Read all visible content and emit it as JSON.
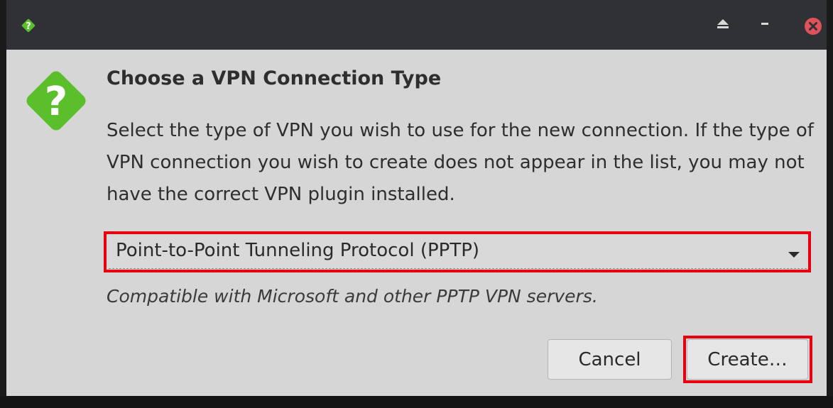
{
  "titlebar": {
    "app_icon": "question-diamond-icon",
    "buttons": [
      "eject-icon",
      "minimize-icon",
      "close-icon"
    ]
  },
  "dialog": {
    "icon": "question-diamond-icon",
    "heading": "Choose a VPN Connection Type",
    "description": "Select the type of VPN you wish to use for the new connection. If the type of VPN connection you wish to create does not appear in the list, you may not have the correct VPN plugin installed.",
    "vpn_type": {
      "selected": "Point-to-Point Tunneling Protocol (PPTP)",
      "hint": "Compatible with Microsoft and other PPTP VPN servers."
    },
    "buttons": {
      "cancel": "Cancel",
      "create": "Create…"
    }
  },
  "colors": {
    "titlebar_bg": "#2f3135",
    "dialog_bg": "#d6d6d6",
    "icon_green": "#5bbf2c",
    "close_red": "#e0525a",
    "highlight_red": "#e8000f"
  }
}
